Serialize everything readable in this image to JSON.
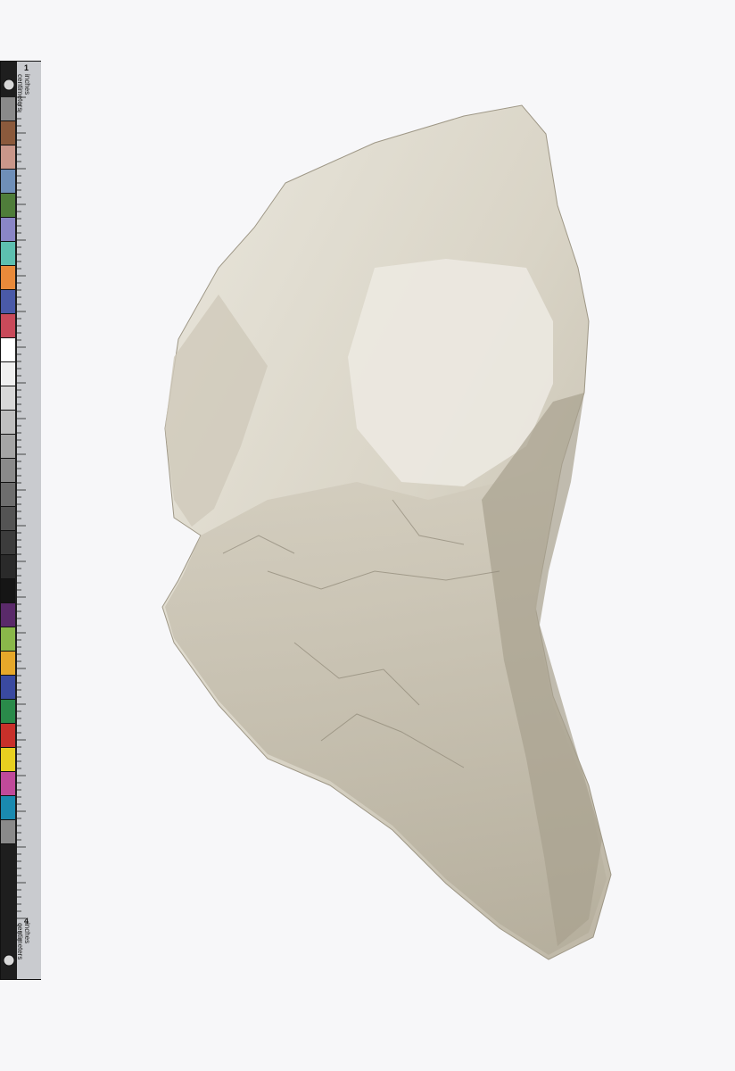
{
  "scale_bar": {
    "top_label_inches": "inches",
    "top_label_cm": "centimeters",
    "bottom_label_inches": "inches",
    "bottom_label_cm": "centimeters",
    "end_number": "1",
    "bottom_number": "4",
    "swatch_colors": [
      "#8a8a8a",
      "#8b5a3c",
      "#c9978a",
      "#6f8fb8",
      "#4f7d3a",
      "#8a86c6",
      "#5dbfb0",
      "#e98a3a",
      "#4a5aa8",
      "#c94a5a",
      "#ffffff",
      "#f0f0f0",
      "#d8d8d8",
      "#bfbfbf",
      "#a5a5a5",
      "#8a8a8a",
      "#6e6e6e",
      "#545454",
      "#3c3c3c",
      "#2a2a2a",
      "#151515",
      "#5a2a6a",
      "#8ab84a",
      "#e6a82a",
      "#3a4aa0",
      "#2a8a4a",
      "#c8302a",
      "#e8d020",
      "#c04a9a",
      "#1a8ab0",
      "#8a8a8a"
    ]
  },
  "colors": {
    "background": "#f7f7f9",
    "stone_light": "#e4e0d6",
    "stone_mid": "#cfc9bb",
    "stone_shadow": "#a9a394"
  }
}
